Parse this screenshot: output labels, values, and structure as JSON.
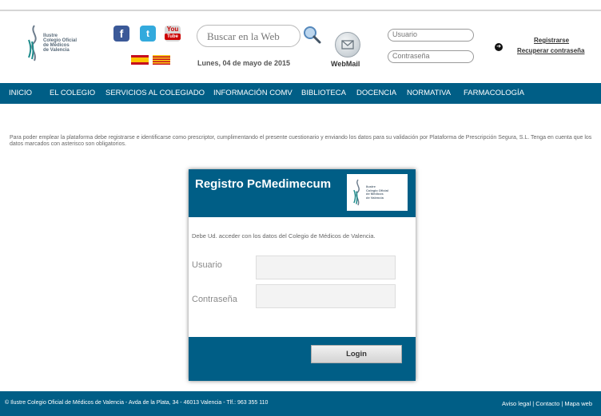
{
  "header": {
    "logo_text": [
      "Ilustre",
      "Colegio Oficial",
      "de Médicos",
      "de Valencia"
    ],
    "search_placeholder": "Buscar en la Web",
    "date": "Lunes, 04 de mayo de 2015",
    "webmail_prefix": "Web",
    "webmail_suffix": "Mail",
    "usuario_placeholder": "Usuario",
    "password_placeholder": "Contraseña",
    "register_link": "Registrarse",
    "recover_link": "Recuperar contraseña",
    "social": {
      "facebook": "f",
      "twitter": "t",
      "youtube_top": "You",
      "youtube_bottom": "Tube"
    }
  },
  "nav": {
    "items": [
      "INICIO",
      "EL COLEGIO",
      "SERVICIOS AL COLEGIADO",
      "INFORMACIÓN COMV",
      "BIBLIOTECA",
      "DOCENCIA",
      "NORMATIVA",
      "FARMACOLOGÍA"
    ]
  },
  "intro_text": "Para poder emplear la plataforma debe registrarse e identificarse como prescriptor, cumplimentando el presente cuestionario y enviando los datos para su validación por Plataforma de Prescripción Segura, S.L. Tenga en cuenta que los datos marcados con asterisco son obligatorios.",
  "card": {
    "title": "Registro PcMedimecum",
    "logo_text": [
      "Ilustre",
      "Colegio Oficial",
      "de Médicos",
      "de Valencia"
    ],
    "message": "Debe Ud. acceder con los datos del Colegio de Médicos de Valencia.",
    "usuario_label": "Usuario",
    "password_label": "Contraseña",
    "login_button": "Login"
  },
  "footer": {
    "left": "© Ilustre Colegio Oficial de Médicos de Valencia - Avda de la Plata, 34 - 46013 Valencia - Tlf.: 963 355 110",
    "right": "Aviso legal | Contacto | Mapa web"
  },
  "colors": {
    "brand_blue": "#005e86"
  },
  "icons": [
    "logo-icon",
    "facebook-icon",
    "twitter-icon",
    "youtube-icon",
    "spain-flag-icon",
    "valencia-flag-icon",
    "search-icon",
    "webmail-icon",
    "arrow-right-icon"
  ]
}
